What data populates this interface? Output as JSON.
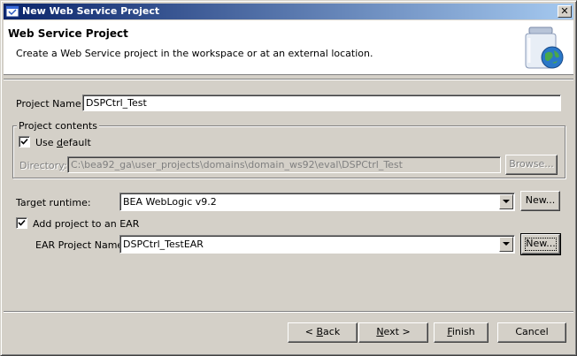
{
  "window": {
    "title": "New Web Service Project",
    "close_glyph": "✕"
  },
  "banner": {
    "title": "Web Service Project",
    "description": "Create a Web Service project in the workspace or at an external location."
  },
  "form": {
    "project_name_label": "Project Name:",
    "project_name_value": "DSPCtrl_Test",
    "project_contents_legend": "Project contents",
    "use_default": {
      "prefix": "Use ",
      "accel": "d",
      "suffix": "efault",
      "checked": true
    },
    "directory": {
      "prefix": "Director",
      "accel": "y",
      "suffix": ":",
      "value": "C:\\bea92_ga\\user_projects\\domains\\domain_ws92\\eval\\DSPCtrl_Test",
      "enabled": false
    },
    "browse_label": "Browse...",
    "target_runtime_label": "Target runtime:",
    "target_runtime_value": "BEA WebLogic v9.2",
    "new_runtime_label": "New...",
    "add_to_ear_label": "Add project to an EAR",
    "add_to_ear_checked": true,
    "ear_project_label": "EAR Project Name:",
    "ear_project_value": "DSPCtrl_TestEAR",
    "new_ear_label": "New..."
  },
  "footer": {
    "back": {
      "prefix": "< ",
      "accel": "B",
      "suffix": "ack"
    },
    "next": {
      "prefix": "",
      "accel": "N",
      "suffix": "ext >"
    },
    "finish": {
      "prefix": "",
      "accel": "F",
      "suffix": "inish"
    },
    "cancel_label": "Cancel"
  },
  "icons": {
    "app": "eclipse-window-icon",
    "banner": "web-service-jar-globe-icon",
    "check": "checkmark-icon",
    "dropdown": "triangle-down-icon"
  },
  "colors": {
    "titlebar_start": "#0a246a",
    "titlebar_end": "#a6caf0",
    "dialog_face": "#d4d0c8"
  }
}
